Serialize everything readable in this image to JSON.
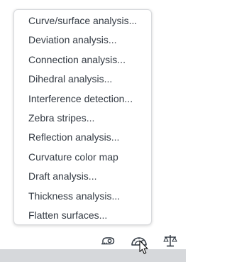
{
  "menu": {
    "items": [
      {
        "label": "Curve/surface analysis..."
      },
      {
        "label": "Deviation analysis..."
      },
      {
        "label": "Connection analysis..."
      },
      {
        "label": "Dihedral analysis..."
      },
      {
        "label": "Interference detection..."
      },
      {
        "label": "Zebra stripes..."
      },
      {
        "label": "Reflection analysis..."
      },
      {
        "label": "Curvature color map"
      },
      {
        "label": "Draft analysis..."
      },
      {
        "label": "Thickness analysis..."
      },
      {
        "label": "Flatten surfaces..."
      }
    ]
  },
  "toolbar": {
    "tools": [
      {
        "icon": "measure-tape-icon"
      },
      {
        "icon": "analysis-protractor-icon",
        "state": "active"
      },
      {
        "icon": "mass-properties-scale-icon"
      }
    ]
  },
  "colors": {
    "menu_text": "#333a43",
    "menu_border": "#d7d9dc",
    "icon": "#2f3740",
    "bottom_strip": "#d6d8db"
  }
}
